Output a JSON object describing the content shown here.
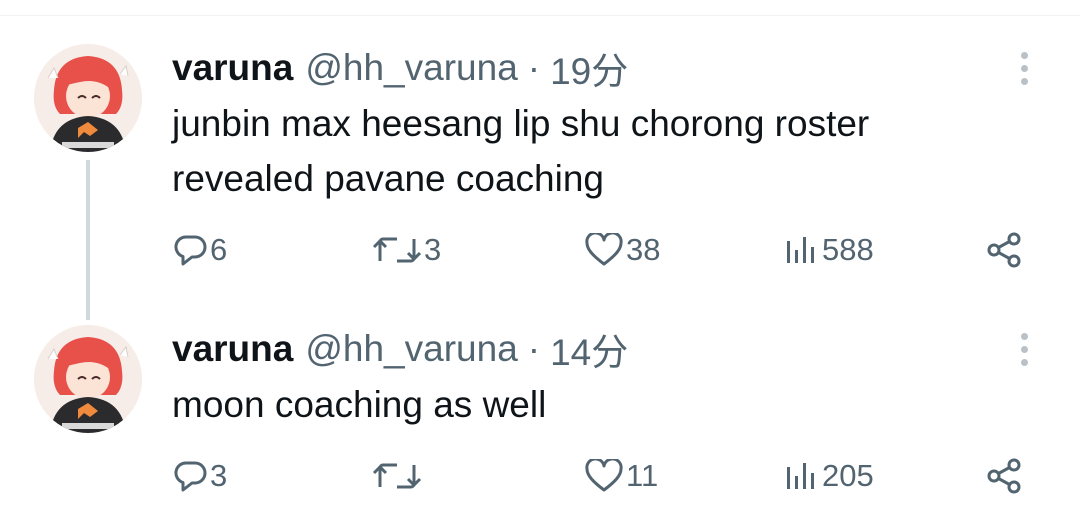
{
  "tweets": [
    {
      "name": "varuna",
      "handle": "@hh_varuna",
      "separator": "·",
      "time": "19分",
      "text_lines": [
        "junbin max heesang lip shu chorong roster",
        "revealed pavane coaching"
      ],
      "replies": "6",
      "retweets": "3",
      "likes": "38",
      "views": "588"
    },
    {
      "name": "varuna",
      "handle": "@hh_varuna",
      "separator": "·",
      "time": "14分",
      "text_lines": [
        "moon coaching as well"
      ],
      "replies": "3",
      "retweets": "",
      "likes": "11",
      "views": "205"
    }
  ],
  "icons": {
    "reply": "reply-icon",
    "retweet": "retweet-icon",
    "like": "heart-icon",
    "views": "views-icon",
    "share": "share-icon",
    "more": "more-vertical-icon"
  },
  "colors": {
    "text": "#0f1419",
    "secondary": "#536471",
    "thread_line": "#cfd9de"
  }
}
